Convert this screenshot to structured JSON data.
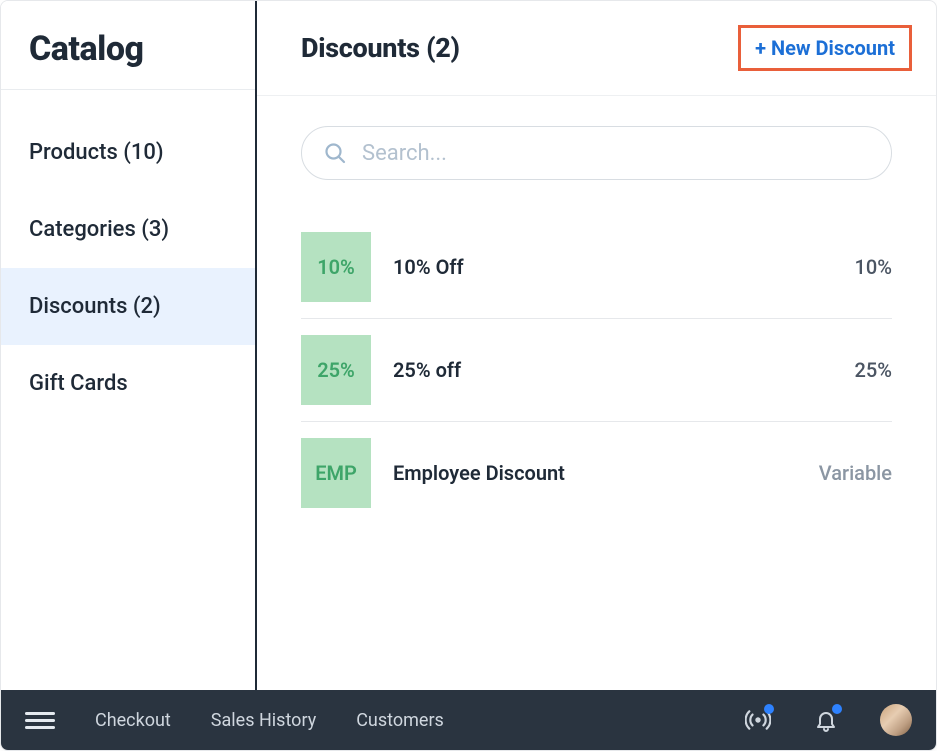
{
  "sidebar": {
    "title": "Catalog",
    "items": [
      {
        "label": "Products (10)",
        "active": false
      },
      {
        "label": "Categories (3)",
        "active": false
      },
      {
        "label": "Discounts (2)",
        "active": true
      },
      {
        "label": "Gift Cards",
        "active": false
      }
    ]
  },
  "main": {
    "title": "Discounts (2)",
    "new_button_label": "+ New Discount",
    "search": {
      "placeholder": "Search..."
    },
    "discounts": [
      {
        "badge": "10%",
        "name": "10% Off",
        "value": "10%",
        "muted": false
      },
      {
        "badge": "25%",
        "name": "25% off",
        "value": "25%",
        "muted": false
      },
      {
        "badge": "EMP",
        "name": "Employee Discount",
        "value": "Variable",
        "muted": true
      }
    ]
  },
  "bottom": {
    "links": [
      {
        "label": "Checkout"
      },
      {
        "label": "Sales History"
      },
      {
        "label": "Customers"
      }
    ]
  }
}
